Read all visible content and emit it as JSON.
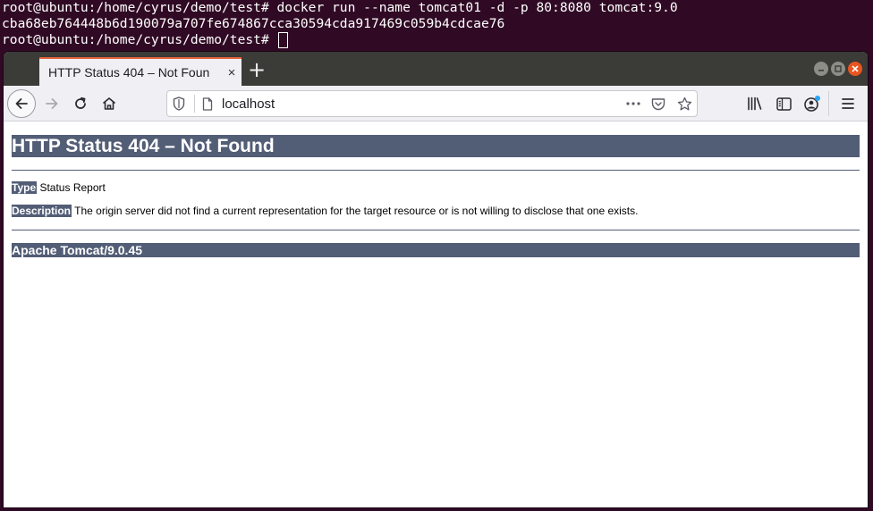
{
  "terminal": {
    "lines": [
      "root@ubuntu:/home/cyrus/demo/test# docker run --name tomcat01 -d -p 80:8080 tomcat:9.0",
      "cba68eb764448b6d190079a707fe674867cca30594cda917469c059b4cdcae76",
      "root@ubuntu:/home/cyrus/demo/test# "
    ]
  },
  "browser": {
    "tab_title": "HTTP Status 404 – Not Foun",
    "tab_close": "×",
    "new_tab": "+",
    "url": "localhost"
  },
  "page": {
    "heading": "HTTP Status 404 – Not Found",
    "type_label": "Type",
    "type_value": " Status Report",
    "description_label": "Description",
    "description_value": " The origin server did not find a current representation for the target resource or is not willing to disclose that one exists.",
    "footer": "Apache Tomcat/9.0.45"
  },
  "colors": {
    "terminal_bg": "#300a24",
    "tomcat_header": "#525d76",
    "tab_accent": "#e8643c",
    "close_button": "#e95420"
  }
}
